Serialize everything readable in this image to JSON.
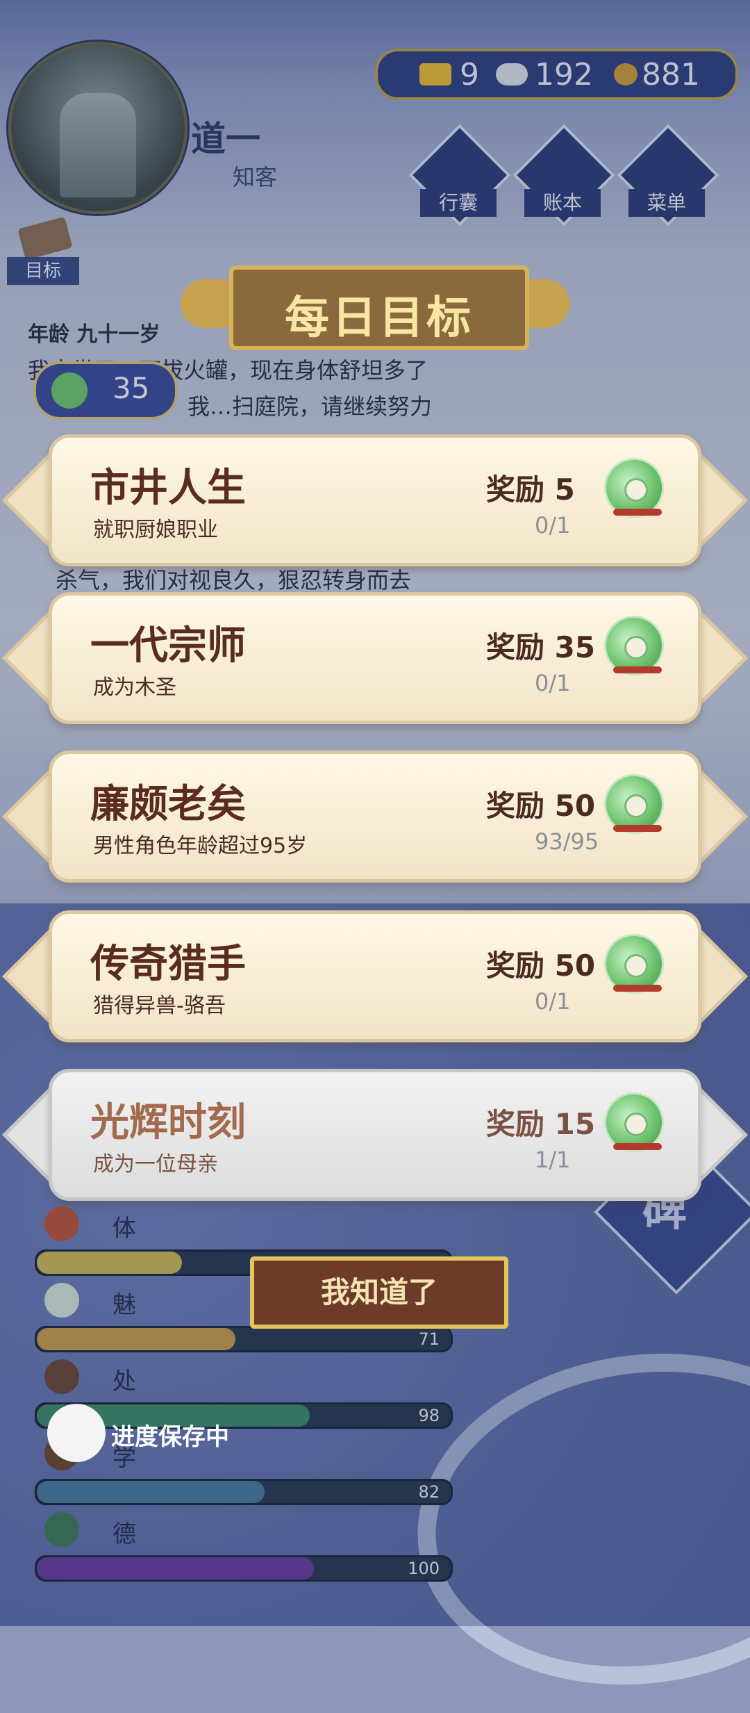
{
  "header": {
    "player_name": "道一",
    "player_title": "知客",
    "currency": {
      "gold": "9",
      "silver": "192",
      "coins": "881"
    },
    "menu": [
      "行囊",
      "账本",
      "菜单"
    ],
    "goal_tab_label": "目标"
  },
  "background_log": {
    "age_line": "年龄 九十一岁",
    "lines": [
      "我去世了…下拔火罐，现在身体舒坦多了",
      "我…扫庭院，请继续努力",
      "杀气，我们对视良久，狠忍转身而去"
    ],
    "jade_badge": "35"
  },
  "dialog": {
    "title": "每日目标",
    "goals": [
      {
        "name": "市井人生",
        "desc": "就职厨娘职业",
        "reward_label": "奖励 5",
        "progress": "0/1",
        "completed": false
      },
      {
        "name": "一代宗师",
        "desc": "成为木圣",
        "reward_label": "奖励 35",
        "progress": "0/1",
        "completed": false
      },
      {
        "name": "廉颇老矣",
        "desc": "男性角色年龄超过95岁",
        "reward_label": "奖励 50",
        "progress": "93/95",
        "completed": false
      },
      {
        "name": "传奇猎手",
        "desc": "猎得异兽-骆吾",
        "reward_label": "奖励 50",
        "progress": "0/1",
        "completed": false
      },
      {
        "name": "光辉时刻",
        "desc": "成为一位母亲",
        "reward_label": "奖励 15",
        "progress": "1/1",
        "completed": true
      }
    ],
    "confirm_label": "我知道了"
  },
  "stats": [
    {
      "label": "体魄",
      "value": "",
      "fraction": 0.35,
      "color": "#c9b45a"
    },
    {
      "label": "魅力",
      "value": "71",
      "fraction": 0.48,
      "color": "#c49a4e"
    },
    {
      "label": "处世",
      "value": "98",
      "fraction": 0.66,
      "color": "#3e8a6a"
    },
    {
      "label": "学识",
      "value": "82",
      "fraction": 0.55,
      "color": "#4a7a9c"
    },
    {
      "label": "德行",
      "value": "100",
      "fraction": 0.67,
      "color": "#6a3e9c"
    }
  ],
  "stele_label": "碑",
  "status": {
    "saving_text": "进度保存中"
  },
  "colors": {
    "card_title": "#5a2b1f",
    "jade": "#6fc36f",
    "banner_gold": "#d7b45a"
  }
}
